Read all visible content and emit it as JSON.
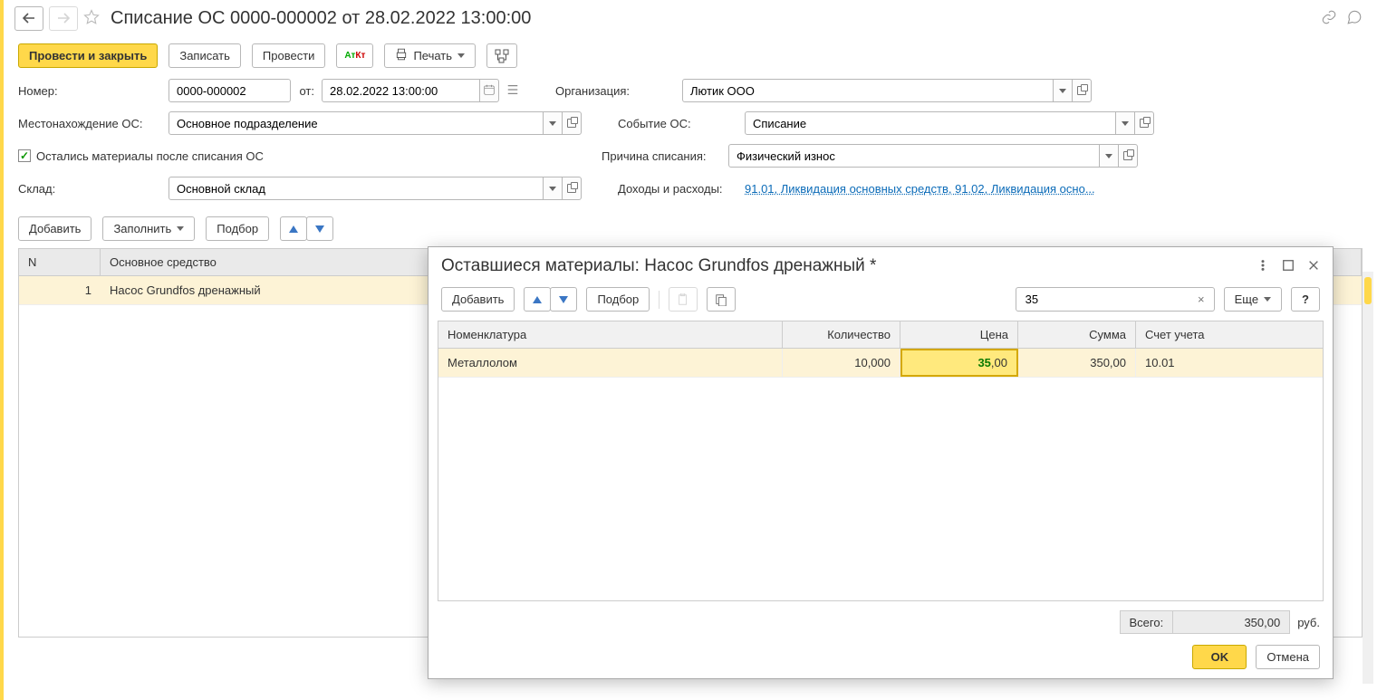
{
  "header": {
    "title": "Списание ОС 0000-000002 от 28.02.2022 13:00:00"
  },
  "toolbar": {
    "post_close": "Провести и закрыть",
    "write": "Записать",
    "post": "Провести",
    "print": "Печать"
  },
  "form": {
    "number_label": "Номер:",
    "number_value": "0000-000002",
    "from_label": "от:",
    "date_value": "28.02.2022 13:00:00",
    "location_label": "Местонахождение ОС:",
    "location_value": "Основное подразделение",
    "checkbox_label": "Остались материалы после списания ОС",
    "warehouse_label": "Склад:",
    "warehouse_value": "Основной склад",
    "org_label": "Организация:",
    "org_value": "Лютик ООО",
    "event_label": "Событие ОС:",
    "event_value": "Списание",
    "reason_label": "Причина списания:",
    "reason_value": "Физический износ",
    "income_label": "Доходы и расходы:",
    "income_value": "91.01, Ликвидация основных средств, 91.02, Ликвидация осно..."
  },
  "grid": {
    "add": "Добавить",
    "fill": "Заполнить",
    "pick": "Подбор",
    "col_n": "N",
    "col_asset": "Основное средство",
    "rows": [
      {
        "n": "1",
        "asset": "Насос Grundfos дренажный"
      }
    ]
  },
  "dialog": {
    "title": "Оставшиеся материалы: Насос Grundfos дренажный *",
    "add": "Добавить",
    "pick": "Подбор",
    "more": "Еще",
    "help": "?",
    "search_value": "35",
    "cols": {
      "nom": "Номенклатура",
      "qty": "Количество",
      "price": "Цена",
      "sum": "Сумма",
      "acc": "Счет учета"
    },
    "rows": [
      {
        "nom": "Металлолом",
        "qty": "10,000",
        "price_whole": "35",
        "price_frac": ",00",
        "sum": "350,00",
        "acc": "10.01"
      }
    ],
    "total_label": "Всего:",
    "total_value": "350,00",
    "currency": "руб.",
    "ok": "OK",
    "cancel": "Отмена"
  }
}
